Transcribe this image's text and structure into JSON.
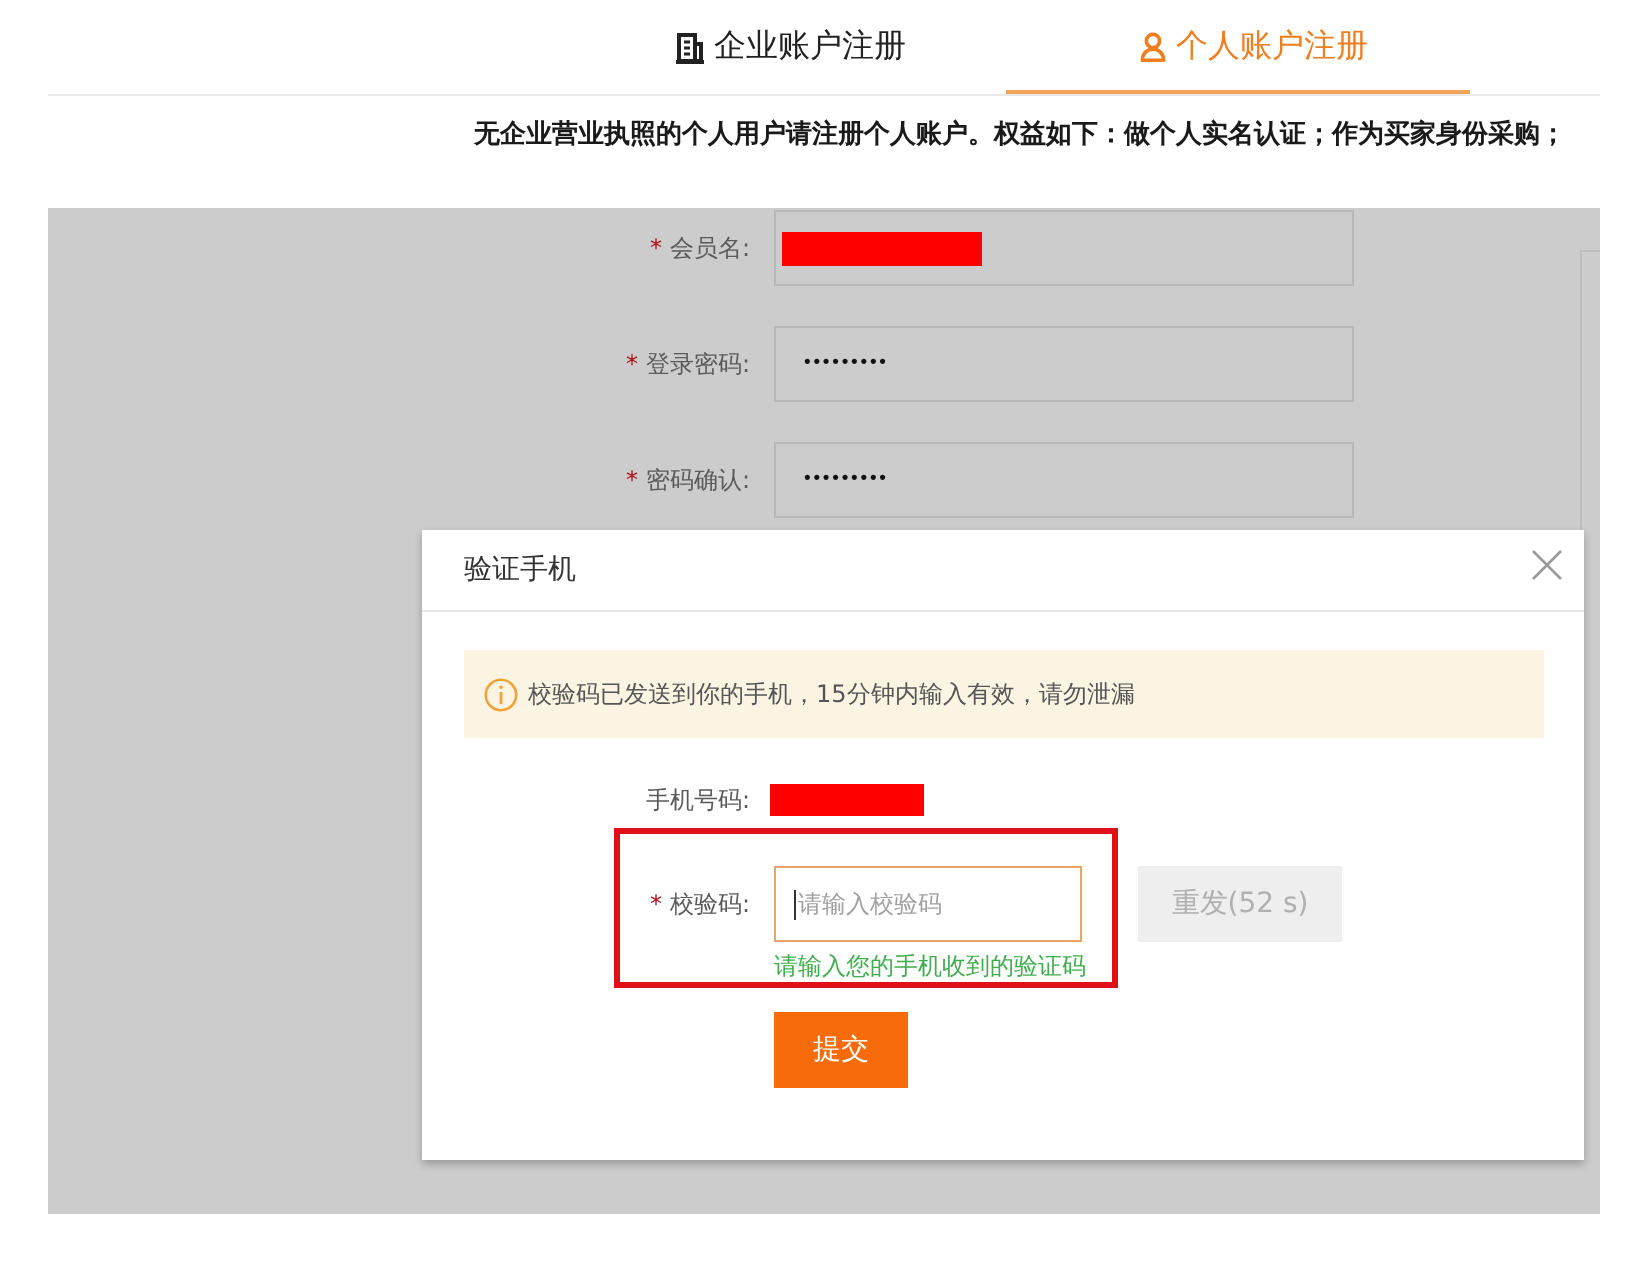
{
  "tabs": [
    {
      "kind": "business",
      "label": "企业账户注册",
      "selected": false
    },
    {
      "kind": "personal",
      "label": "个人账户注册",
      "selected": true
    }
  ],
  "notice": "无企业营业执照的个人用户请注册个人账户。权益如下：做个人实名认证；作为买家身份采购；",
  "form": {
    "fields": [
      {
        "kind": "text",
        "required_mark": "*",
        "label": "会员名:",
        "redacted": true
      },
      {
        "kind": "password",
        "required_mark": "*",
        "label": "登录密码:",
        "redacted": false,
        "value": "•••••••••"
      },
      {
        "kind": "password",
        "required_mark": "*",
        "label": "密码确认:",
        "redacted": false,
        "value": "•••••••••"
      }
    ]
  },
  "dialog": {
    "title": "验证手机",
    "alert": "校验码已发送到你的手机，15分钟内输入有效，请勿泄漏",
    "phone": {
      "label": "手机号码:",
      "redacted": true
    },
    "code_field": {
      "required_mark": "*",
      "label": "校验码:",
      "placeholder": "请输入校验码",
      "focused": true,
      "highlighted": true,
      "hint": "请输入您的手机收到的验证码"
    },
    "resend_button": {
      "label": "重发(52 s)",
      "disabled": true
    },
    "submit_button": {
      "label": "提交"
    }
  }
}
